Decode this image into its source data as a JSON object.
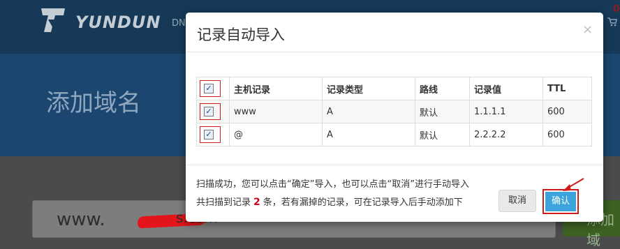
{
  "background": {
    "brand": "YUNDUN",
    "nav_partial": "DN",
    "cart_count": "0",
    "page_heading": "添加域名",
    "domain_prefix": "www.",
    "domain_suffix": "s.com",
    "add_button_partial": "添加域"
  },
  "modal": {
    "title": "记录自动导入",
    "close_symbol": "×",
    "table": {
      "headers": [
        "主机记录",
        "记录类型",
        "路线",
        "记录值",
        "TTL"
      ],
      "rows": [
        [
          "www",
          "A",
          "默认",
          "1.1.1.1",
          "600"
        ],
        [
          "@",
          "A",
          "默认",
          "2.2.2.2",
          "600"
        ]
      ]
    },
    "message_line1": "扫描成功，您可以点击“确定”导入，也可以点击“取消”进行手动导入",
    "message_line2_before": "共扫描到记录",
    "record_count": "2",
    "message_line2_after": "条，若有漏掉的记录，可在记录导入后手动添加下",
    "cancel_label": "取消",
    "confirm_label": "确认"
  },
  "colors": {
    "header_bg": "#163958",
    "confirm_bg": "#3ba4dc",
    "highlight_red": "#d21a1a"
  }
}
